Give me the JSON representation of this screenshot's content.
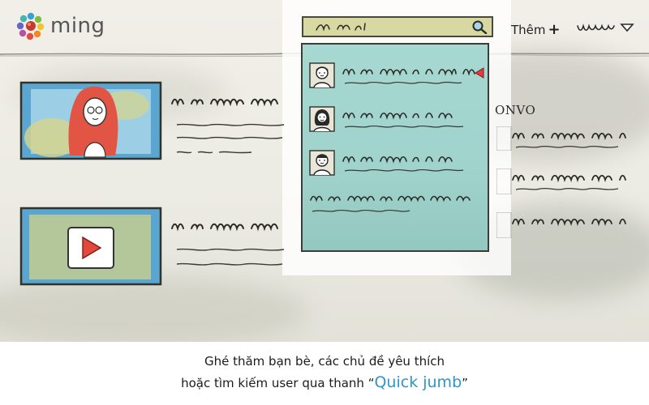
{
  "app": {
    "logo_text": "ming",
    "accent_color": "#2e96c8",
    "icon": "flower-logo-icon"
  },
  "header": {
    "search": {
      "query": "~ ~~ ı",
      "icon": "search-icon"
    },
    "more_label": "Thêm",
    "more_icon": "plus-icon",
    "user_menu_icon": "dropdown-caret-icon"
  },
  "quick_search": {
    "results": [
      {
        "kind": "user",
        "icon": "user-avatar-icon"
      },
      {
        "kind": "user",
        "icon": "user-avatar-icon"
      },
      {
        "kind": "user",
        "icon": "user-avatar-icon"
      }
    ],
    "selected_marker_icon": "pointer-arrow-icon"
  },
  "sidebar": {
    "label": "ONVO"
  },
  "caption": {
    "line1": "Ghé thăm bạn bè, các chủ đề yêu thích",
    "line2_prefix": "hoặc tìm kiếm user qua thanh “",
    "line2_highlight": "Quick jumb",
    "line2_suffix": "”"
  }
}
